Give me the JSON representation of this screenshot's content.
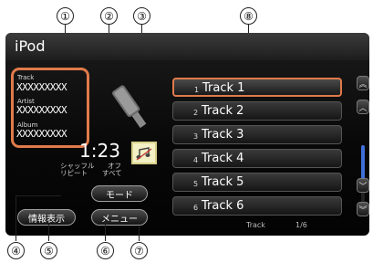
{
  "callouts": [
    "①",
    "②",
    "③",
    "⑧",
    "④",
    "⑤",
    "⑥",
    "⑦"
  ],
  "screen": {
    "title": "iPod",
    "info": {
      "track_label": "Track",
      "track_value": "XXXXXXXXX",
      "artist_label": "Artist",
      "artist_value": "XXXXXXXXX",
      "album_label": "Album",
      "album_value": "XXXXXXXXX"
    },
    "time": "1:23",
    "status": {
      "shuffle_label": "シャッフル",
      "shuffle_value": "オフ",
      "repeat_label": "リピート",
      "repeat_value": "すべて"
    },
    "buttons": {
      "mode": "モード",
      "info_display": "情報表示",
      "menu": "メニュー"
    },
    "tracks": [
      {
        "num": "1",
        "title": "Track 1"
      },
      {
        "num": "2",
        "title": "Track 2"
      },
      {
        "num": "3",
        "title": "Track 3"
      },
      {
        "num": "4",
        "title": "Track 4"
      },
      {
        "num": "5",
        "title": "Track 5"
      },
      {
        "num": "6",
        "title": "Track 6"
      }
    ],
    "footer": {
      "label": "Track",
      "count": "1/6"
    },
    "colors": {
      "accent": "#e07a4a",
      "scroll": "#3f6fd8"
    }
  }
}
